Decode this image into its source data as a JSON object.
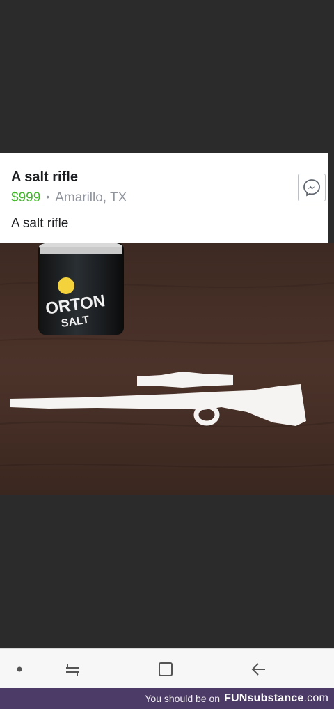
{
  "listing": {
    "title": "A salt rifle",
    "price": "$999",
    "separator": "•",
    "location": "Amarillo, TX",
    "description": "A salt rifle",
    "message_icon": "messenger-icon"
  },
  "photo": {
    "can_brand": "ORTON",
    "can_sub": "SALT"
  },
  "nav": {
    "dot_icon": "dot-icon",
    "recents_icon": "recents-icon",
    "home_icon": "home-icon",
    "back_icon": "back-arrow-icon"
  },
  "footer": {
    "text": "You should be on",
    "brand_bold": "FUN",
    "brand_rest": "substance",
    "brand_tld": ".com"
  },
  "colors": {
    "price": "#42b72a",
    "footer_bg": "#4d3b67",
    "background": "#2b2b2b"
  }
}
